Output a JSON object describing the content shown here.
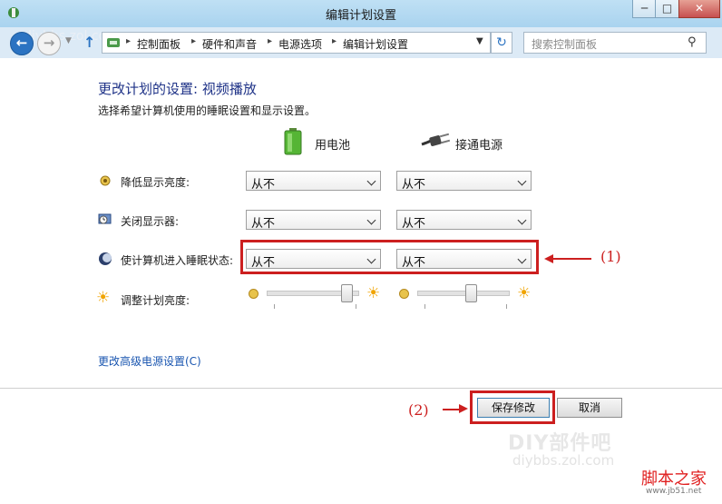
{
  "window": {
    "title": "编辑计划设置",
    "min_glyph": "─",
    "max_glyph": "□",
    "close_glyph": "✕"
  },
  "nav": {
    "breadcrumbs": [
      "控制面板",
      "硬件和声音",
      "电源选项",
      "编辑计划设置"
    ],
    "breadcrumb_sep": "▸",
    "search_placeholder": "搜索控制面板"
  },
  "page": {
    "heading": "更改计划的设置: 视频播放",
    "subtext": "选择希望计算机使用的睡眠设置和显示设置。",
    "col_battery": "用电池",
    "col_plugged": "接通电源",
    "rows": [
      {
        "label": "降低显示亮度:",
        "battery": "从不",
        "plugged": "从不"
      },
      {
        "label": "关闭显示器:",
        "battery": "从不",
        "plugged": "从不"
      },
      {
        "label": "使计算机进入睡眠状态:",
        "battery": "从不",
        "plugged": "从不"
      }
    ],
    "brightness_label": "调整计划亮度:",
    "brightness": {
      "battery": 0.92,
      "plugged": 0.6
    },
    "advanced_link": "更改高级电源设置(C)"
  },
  "buttons": {
    "save": "保存修改",
    "cancel": "取消"
  },
  "annotations": {
    "one": "(1)",
    "two": "(2)"
  },
  "watermarks": {
    "diy": "DIY部件吧",
    "diy_url": "diybbs.zol.com",
    "jb": "脚本之家",
    "jb_url": "www.jb51.net"
  },
  "colors": {
    "accent": "#1e3287",
    "highlight": "#cc1f1f",
    "link": "#1a56b0"
  }
}
